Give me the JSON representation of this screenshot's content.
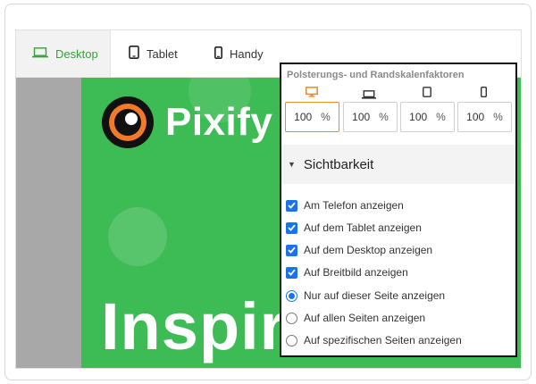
{
  "tabs": [
    {
      "label": "Desktop",
      "icon": "laptop-icon",
      "active": true
    },
    {
      "label": "Tablet",
      "icon": "tablet-icon",
      "active": false
    },
    {
      "label": "Handy",
      "icon": "phone-icon",
      "active": false
    }
  ],
  "canvas": {
    "brand": "Pixify",
    "headline": "Inspir"
  },
  "panel": {
    "title": "Polsterungs- und Randskalenfaktoren",
    "scales": [
      {
        "device": "desktop-icon",
        "value": "100",
        "unit": "%"
      },
      {
        "device": "laptop-icon",
        "value": "100",
        "unit": "%"
      },
      {
        "device": "tablet-icon",
        "value": "100",
        "unit": "%"
      },
      {
        "device": "phone-icon",
        "value": "100",
        "unit": "%"
      }
    ],
    "section": "Sichtbarkeit",
    "checkboxes": [
      {
        "label": "Am Telefon anzeigen",
        "checked": true
      },
      {
        "label": "Auf dem Tablet anzeigen",
        "checked": true
      },
      {
        "label": "Auf dem Desktop anzeigen",
        "checked": true
      },
      {
        "label": "Auf Breitbild anzeigen",
        "checked": true
      }
    ],
    "radios": [
      {
        "label": "Nur auf dieser Seite anzeigen",
        "selected": true
      },
      {
        "label": "Auf allen Seiten anzeigen",
        "selected": false
      },
      {
        "label": "Auf spezifischen Seiten anzeigen",
        "selected": false
      }
    ]
  },
  "colors": {
    "accent_green": "#3aa03a",
    "canvas_green": "#3dbb54",
    "active_orange": "#e98a2b",
    "check_blue": "#1a73e8"
  }
}
